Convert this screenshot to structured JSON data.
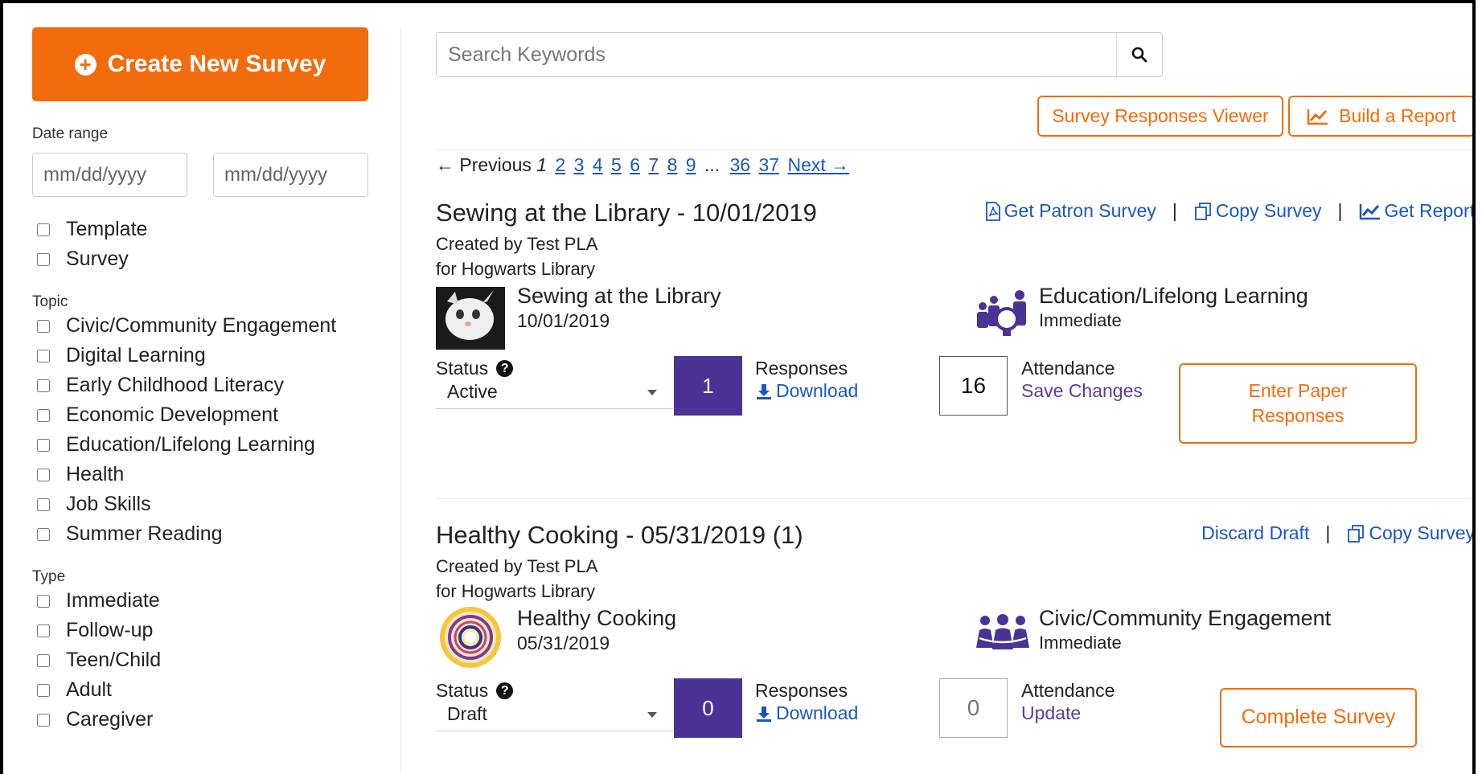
{
  "sidebar": {
    "create_label": "Create New Survey",
    "date_range_label": "Date range",
    "date_from_placeholder": "mm/dd/yyyy",
    "date_to_placeholder": "mm/dd/yyyy",
    "kind_options": [
      "Template",
      "Survey"
    ],
    "topic_label": "Topic",
    "topics": [
      "Civic/Community Engagement",
      "Digital Learning",
      "Early Childhood Literacy",
      "Economic Development",
      "Education/Lifelong Learning",
      "Health",
      "Job Skills",
      "Summer Reading"
    ],
    "type_label": "Type",
    "types": [
      "Immediate",
      "Follow-up",
      "Teen/Child",
      "Adult",
      "Caregiver"
    ]
  },
  "search": {
    "placeholder": "Search Keywords",
    "icon": "search-icon"
  },
  "toolbar": {
    "viewer_label": "Survey Responses Viewer",
    "report_label": "Build a Report"
  },
  "pagination": {
    "previous": "← Previous",
    "current": "1",
    "pages": [
      "2",
      "3",
      "4",
      "5",
      "6",
      "7",
      "8",
      "9"
    ],
    "ellipsis": "...",
    "last_pages": [
      "36",
      "37"
    ],
    "next": "Next →"
  },
  "surveys": [
    {
      "title": "Sewing at the Library - 10/01/2019",
      "created_by": "Created by Test PLA",
      "for_library": "for Hogwarts Library",
      "actions": [
        "Get Patron Survey",
        "Copy Survey",
        "Get Report"
      ],
      "item_name": "Sewing at the Library",
      "item_date": "10/01/2019",
      "topic": "Education/Lifelong Learning",
      "type": "Immediate",
      "status_label": "Status",
      "status_value": "Active",
      "responses_count": "1",
      "responses_label": "Responses",
      "download_label": "Download",
      "attendance_value": "16",
      "attendance_label": "Attendance",
      "attendance_action": "Save Changes",
      "cta_label": "Enter Paper Responses"
    },
    {
      "title": "Healthy Cooking - 05/31/2019 (1)",
      "created_by": "Created by Test PLA",
      "for_library": "for Hogwarts Library",
      "actions": [
        "Discard Draft",
        "Copy Survey"
      ],
      "item_name": "Healthy Cooking",
      "item_date": "05/31/2019",
      "topic": "Civic/Community Engagement",
      "type": "Immediate",
      "status_label": "Status",
      "status_value": "Draft",
      "responses_count": "0",
      "responses_label": "Responses",
      "download_label": "Download",
      "attendance_placeholder": "0",
      "attendance_label": "Attendance",
      "attendance_action": "Update",
      "cta_label": "Complete Survey"
    }
  ],
  "colors": {
    "accent": "#f26c0d",
    "link": "#1a56c4",
    "purple": "#4b3396",
    "topic_icon": "#4b3396"
  }
}
